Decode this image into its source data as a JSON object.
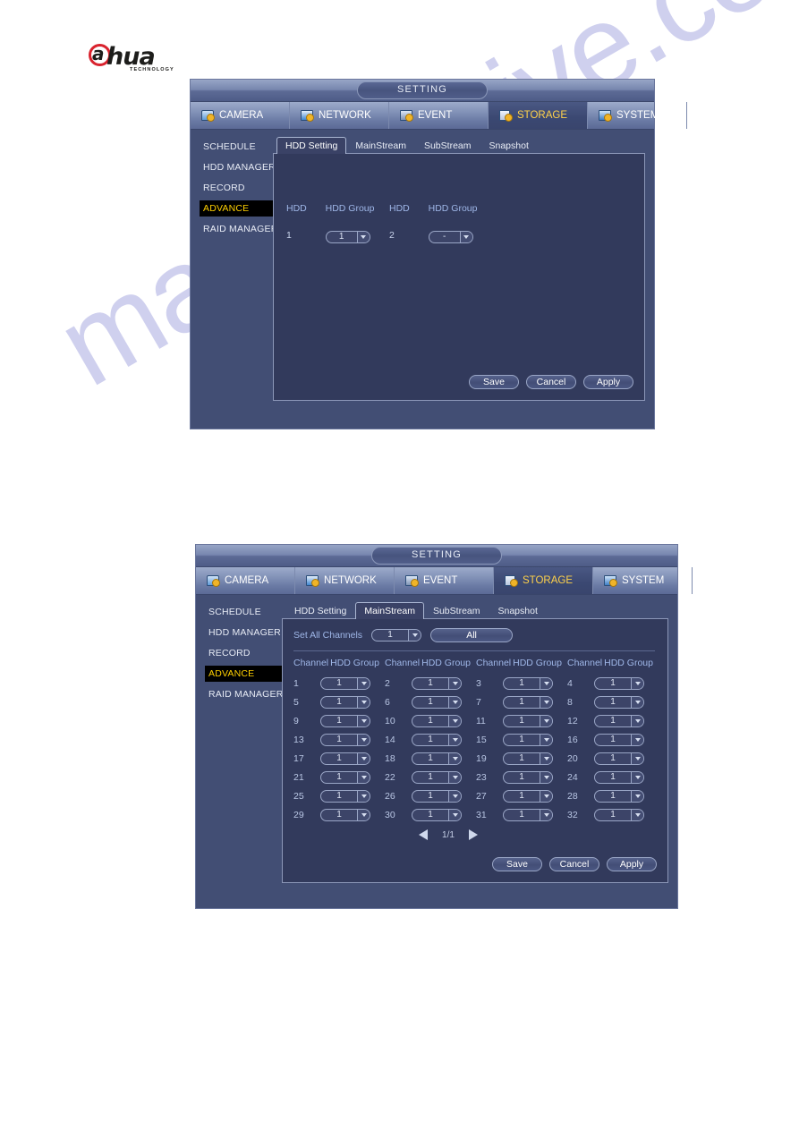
{
  "brand": {
    "logo_letter": "a",
    "logo_text": "hua",
    "logo_sub": "TECHNOLOGY"
  },
  "watermark": {
    "text": "manualshive.com"
  },
  "window": {
    "title": "SETTING",
    "top_tabs": [
      {
        "label": "CAMERA",
        "icon": "camera-icon",
        "active": false
      },
      {
        "label": "NETWORK",
        "icon": "network-icon",
        "active": false
      },
      {
        "label": "EVENT",
        "icon": "event-icon",
        "active": false
      },
      {
        "label": "STORAGE",
        "icon": "storage-icon",
        "active": true
      },
      {
        "label": "SYSTEM",
        "icon": "system-icon",
        "active": false
      }
    ],
    "sidebar": [
      {
        "label": "SCHEDULE",
        "active": false
      },
      {
        "label": "HDD MANAGER",
        "active": false
      },
      {
        "label": "RECORD",
        "active": false
      },
      {
        "label": "ADVANCE",
        "active": true
      },
      {
        "label": "RAID MANAGER",
        "active": false
      }
    ],
    "buttons": {
      "save": "Save",
      "cancel": "Cancel",
      "apply": "Apply"
    }
  },
  "colors": {
    "dialog_bg": "#424e74",
    "panel_bg": "#323a5c",
    "accent_active_tab": "#ffd24a",
    "sidebar_active_text": "#ffd000",
    "sidebar_active_bg": "#000000",
    "label_blue": "#9fb7e8",
    "logo_red": "#d9232e"
  },
  "panel_hdd_setting": {
    "inner_tabs": [
      {
        "label": "HDD Setting",
        "active": true
      },
      {
        "label": "MainStream",
        "active": false
      },
      {
        "label": "SubStream",
        "active": false
      },
      {
        "label": "Snapshot",
        "active": false
      }
    ],
    "table": {
      "headers": [
        "HDD",
        "HDD Group",
        "HDD",
        "HDD Group"
      ],
      "rows": [
        {
          "hdd_a": "1",
          "group_a": "1",
          "hdd_b": "2",
          "group_b": "-"
        }
      ]
    }
  },
  "panel_mainstream": {
    "inner_tabs": [
      {
        "label": "HDD Setting",
        "active": false
      },
      {
        "label": "MainStream",
        "active": true
      },
      {
        "label": "SubStream",
        "active": false
      },
      {
        "label": "Snapshot",
        "active": false
      }
    ],
    "set_all": {
      "label": "Set All Channels",
      "value": "1",
      "all_button": "All"
    },
    "grid": {
      "headers": [
        "Channel",
        "HDD Group"
      ],
      "header_groups": 4,
      "channels": [
        {
          "ch": "1",
          "group": "1"
        },
        {
          "ch": "2",
          "group": "1"
        },
        {
          "ch": "3",
          "group": "1"
        },
        {
          "ch": "4",
          "group": "1"
        },
        {
          "ch": "5",
          "group": "1"
        },
        {
          "ch": "6",
          "group": "1"
        },
        {
          "ch": "7",
          "group": "1"
        },
        {
          "ch": "8",
          "group": "1"
        },
        {
          "ch": "9",
          "group": "1"
        },
        {
          "ch": "10",
          "group": "1"
        },
        {
          "ch": "11",
          "group": "1"
        },
        {
          "ch": "12",
          "group": "1"
        },
        {
          "ch": "13",
          "group": "1"
        },
        {
          "ch": "14",
          "group": "1"
        },
        {
          "ch": "15",
          "group": "1"
        },
        {
          "ch": "16",
          "group": "1"
        },
        {
          "ch": "17",
          "group": "1"
        },
        {
          "ch": "18",
          "group": "1"
        },
        {
          "ch": "19",
          "group": "1"
        },
        {
          "ch": "20",
          "group": "1"
        },
        {
          "ch": "21",
          "group": "1"
        },
        {
          "ch": "22",
          "group": "1"
        },
        {
          "ch": "23",
          "group": "1"
        },
        {
          "ch": "24",
          "group": "1"
        },
        {
          "ch": "25",
          "group": "1"
        },
        {
          "ch": "26",
          "group": "1"
        },
        {
          "ch": "27",
          "group": "1"
        },
        {
          "ch": "28",
          "group": "1"
        },
        {
          "ch": "29",
          "group": "1"
        },
        {
          "ch": "30",
          "group": "1"
        },
        {
          "ch": "31",
          "group": "1"
        },
        {
          "ch": "32",
          "group": "1"
        }
      ]
    },
    "pager": {
      "prev": "prev-page-arrow",
      "label": "1/1",
      "next": "next-page-arrow"
    }
  }
}
